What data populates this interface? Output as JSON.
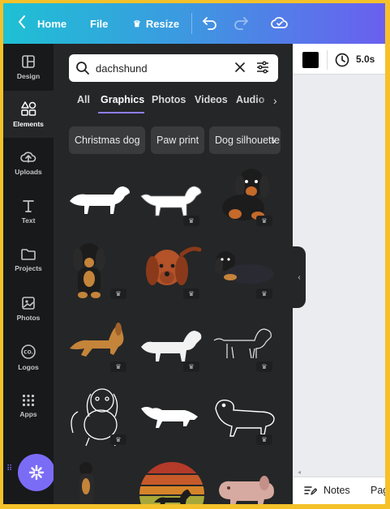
{
  "topbar": {
    "home_label": "Home",
    "file_label": "File",
    "resize_label": "Resize"
  },
  "rail": {
    "items": [
      {
        "label": "Design",
        "icon": "layout-icon"
      },
      {
        "label": "Elements",
        "icon": "shapes-icon"
      },
      {
        "label": "Uploads",
        "icon": "cloud-upload-icon"
      },
      {
        "label": "Text",
        "icon": "text-icon"
      },
      {
        "label": "Projects",
        "icon": "folder-icon"
      },
      {
        "label": "Photos",
        "icon": "image-icon"
      },
      {
        "label": "Logos",
        "icon": "logo-icon"
      },
      {
        "label": "Apps",
        "icon": "apps-grid-icon"
      }
    ],
    "active": "Elements"
  },
  "search": {
    "value": "dachshund"
  },
  "tabs": [
    {
      "label": "All"
    },
    {
      "label": "Graphics"
    },
    {
      "label": "Photos"
    },
    {
      "label": "Videos"
    },
    {
      "label": "Audio"
    }
  ],
  "active_tab": "Graphics",
  "chips": [
    {
      "label": "Christmas dog"
    },
    {
      "label": "Paw print"
    },
    {
      "label": "Dog silhouette"
    }
  ],
  "graphics": [
    {
      "name": "white-dachshund-silhouette",
      "premium": false
    },
    {
      "name": "white-dachshund-outline",
      "premium": true
    },
    {
      "name": "black-tan-dachshund-sitting",
      "premium": true
    },
    {
      "name": "black-tan-dachshund-front",
      "premium": true
    },
    {
      "name": "red-dachshund-face",
      "premium": true
    },
    {
      "name": "black-dachshund-lying",
      "premium": true
    },
    {
      "name": "tan-dachshund-jumping",
      "premium": true
    },
    {
      "name": "white-dachshund-shape",
      "premium": true
    },
    {
      "name": "dachshund-line-drawing",
      "premium": true
    },
    {
      "name": "dachshund-sketch-sitting",
      "premium": true
    },
    {
      "name": "white-dachshund-standing",
      "premium": false
    },
    {
      "name": "dachshund-outline-white",
      "premium": true
    },
    {
      "name": "dachshund-standing-up",
      "premium": true
    },
    {
      "name": "retro-sunset-dachshund",
      "premium": false
    },
    {
      "name": "pink-dachshund-toy",
      "premium": false
    }
  ],
  "canvas": {
    "duration": "5.0s",
    "fill_color": "#000000",
    "notes_label": "Notes",
    "pages_label": "Pag"
  },
  "colors": {
    "accent": "#8b7ff8",
    "panel_bg": "#252627",
    "rail_bg": "#18191b"
  }
}
